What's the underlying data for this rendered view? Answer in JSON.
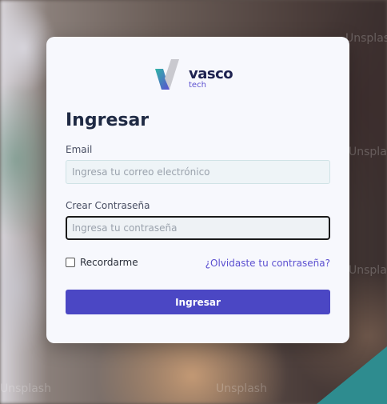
{
  "background": {
    "watermark_text": "Unsplash"
  },
  "brand": {
    "name": "vasco",
    "sub": "tech",
    "colors": {
      "mark_start": "#2fb6a6",
      "mark_end": "#5b4fd0",
      "name": "#1e2250"
    }
  },
  "login": {
    "title": "Ingresar",
    "email_label": "Email",
    "email_placeholder": "Ingresa tu correo electrónico",
    "email_value": "",
    "password_label": "Crear Contraseña",
    "password_placeholder": "Ingresa tu contraseña",
    "password_value": "",
    "remember_label": "Recordarme",
    "remember_checked": false,
    "forgot_link": "¿Olvidaste tu contraseña?",
    "submit_label": "Ingresar",
    "accent_color": "#4b47c4"
  }
}
